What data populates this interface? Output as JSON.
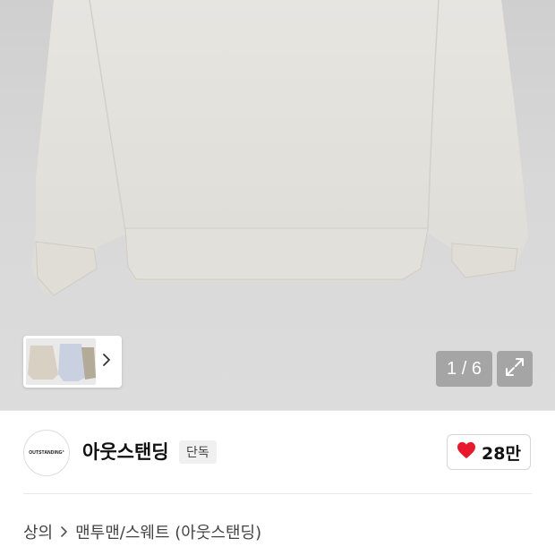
{
  "gallery": {
    "counter": "1 / 6",
    "next_icon": "chevron-right-icon",
    "expand_icon": "expand-arrows-icon"
  },
  "brand": {
    "logo_text": "OUTSTANDING°",
    "name": "아웃스탠딩",
    "badge": "단독"
  },
  "like": {
    "icon": "heart-icon",
    "count": "28만",
    "color": "#e8192c"
  },
  "breadcrumb": {
    "level1": "상의",
    "separator_icon": "chevron-right-icon",
    "level2": "맨투맨/스웨트 (아웃스탠딩)"
  }
}
